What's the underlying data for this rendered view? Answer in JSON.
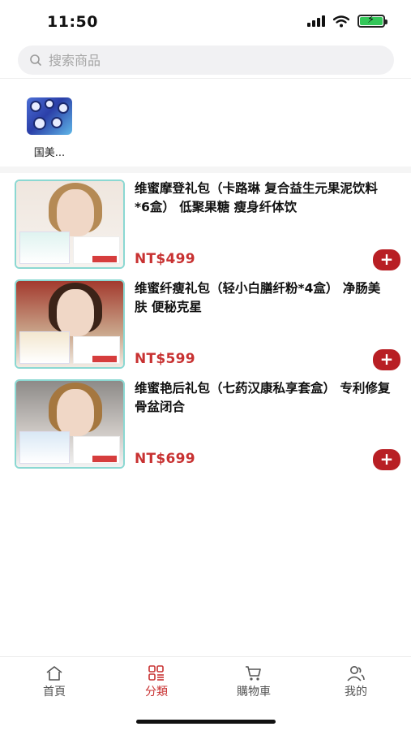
{
  "status_bar": {
    "time": "11:50"
  },
  "search": {
    "placeholder": "搜索商品"
  },
  "categories": [
    {
      "label": "国美..."
    }
  ],
  "products": [
    {
      "title": "维蜜摩登礼包（卡路琳 复合益生元果泥饮料*6盒） 低聚果糖 瘦身纤体饮",
      "price": "NT$499"
    },
    {
      "title": "维蜜纤瘦礼包（轻小白膳纤粉*4盒） 净肠美肤 便秘克星",
      "price": "NT$599"
    },
    {
      "title": "维蜜艳后礼包（七药汉康私享套盒） 专利修复骨盆闭合",
      "price": "NT$699"
    }
  ],
  "tab_bar": {
    "items": [
      {
        "label": "首頁",
        "icon": "home-icon"
      },
      {
        "label": "分類",
        "icon": "category-grid-icon"
      },
      {
        "label": "購物車",
        "icon": "cart-icon"
      },
      {
        "label": "我的",
        "icon": "user-icon"
      }
    ],
    "active_index": 1
  },
  "colors": {
    "accent": "#c83232",
    "add_button": "#b81f24",
    "battery": "#34c759"
  }
}
